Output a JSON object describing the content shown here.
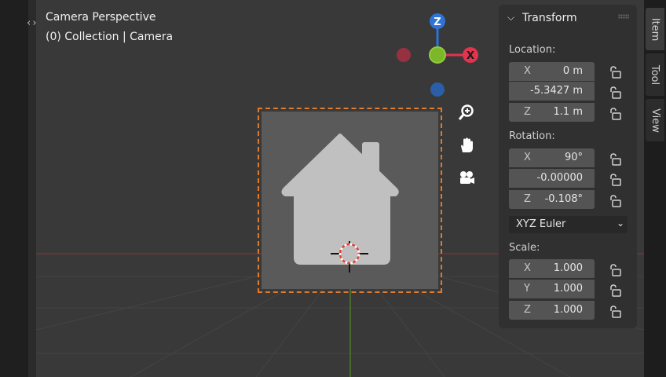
{
  "viewport": {
    "title": "Camera Perspective",
    "subtitle": "(0) Collection | Camera"
  },
  "gizmo": {
    "z_label": "Z",
    "x_label": "X",
    "colors": {
      "x": "#e2344e",
      "y": "#7cb72a",
      "z": "#2e73d6",
      "neg_x": "#96323f",
      "neg_z": "#2a5ea8"
    }
  },
  "nav_buttons": [
    {
      "name": "zoom-icon"
    },
    {
      "name": "hand-pan-icon"
    },
    {
      "name": "camera-view-icon"
    }
  ],
  "transform_panel": {
    "title": "Transform",
    "location": {
      "label": "Location:",
      "x": {
        "axis": "X",
        "value": "0 m"
      },
      "y": {
        "axis": "",
        "value": "-5.3427 m"
      },
      "z": {
        "axis": "Z",
        "value": "1.1 m"
      }
    },
    "rotation": {
      "label": "Rotation:",
      "x": {
        "axis": "X",
        "value": "90°"
      },
      "y": {
        "axis": "",
        "value": "-0.00000"
      },
      "z": {
        "axis": "Z",
        "value": "-0.108°"
      }
    },
    "rotation_mode": "XYZ Euler",
    "scale": {
      "label": "Scale:",
      "x": {
        "axis": "X",
        "value": "1.000"
      },
      "y": {
        "axis": "Y",
        "value": "1.000"
      },
      "z": {
        "axis": "Z",
        "value": "1.000"
      }
    }
  },
  "sidebar_tabs": {
    "item": "Item",
    "tool": "Tool",
    "view": "View"
  },
  "colors": {
    "camera_frame": "#e07a2c",
    "x_axis_line": "#7a3232",
    "y_axis_line": "#4d7a2c"
  }
}
